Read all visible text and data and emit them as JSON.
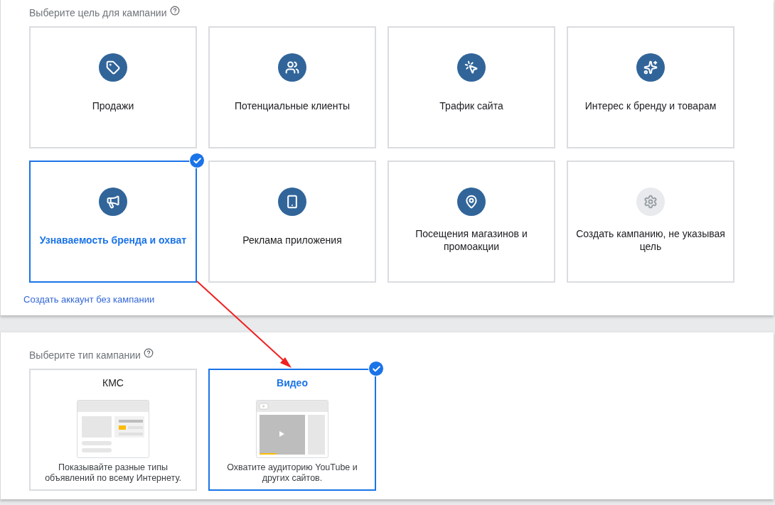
{
  "goal_section": {
    "heading": "Выберите цель для кампании",
    "goals": [
      {
        "label": "Продажи",
        "selected": false
      },
      {
        "label": "Потенциальные клиенты",
        "selected": false
      },
      {
        "label": "Трафик сайта",
        "selected": false
      },
      {
        "label": "Интерес к бренду и товарам",
        "selected": false
      },
      {
        "label": "Узнаваемость бренда и охват",
        "selected": true
      },
      {
        "label": "Реклама приложения",
        "selected": false
      },
      {
        "label": "Посещения магазинов и промоакции",
        "selected": false
      },
      {
        "label": "Создать кампанию, не указывая цель",
        "selected": false
      }
    ],
    "link": "Создать аккаунт без кампании"
  },
  "type_section": {
    "heading": "Выберите тип кампании",
    "types": [
      {
        "kind": "display",
        "title": "КМС",
        "description": "Показывайте разные типы объявлений по всему Интернету.",
        "selected": false
      },
      {
        "kind": "video",
        "title": "Видео",
        "description": "Охватите аудиторию YouTube и других сайтов.",
        "selected": true
      }
    ]
  }
}
